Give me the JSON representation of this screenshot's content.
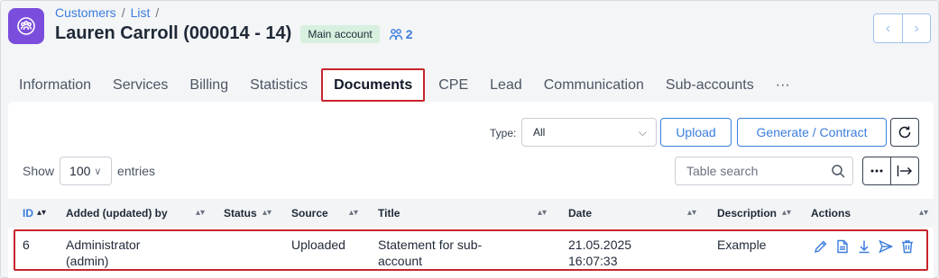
{
  "breadcrumb": {
    "items": [
      "Customers",
      "List"
    ],
    "separator": "/"
  },
  "header": {
    "title": "Lauren Carroll (000014 - 14)",
    "badge": "Main account",
    "subaccount_count": "2"
  },
  "tabs": [
    "Information",
    "Services",
    "Billing",
    "Statistics",
    "Documents",
    "CPE",
    "Lead",
    "Communication",
    "Sub-accounts",
    "···"
  ],
  "active_tab": "Documents",
  "toolbar": {
    "type_label": "Type:",
    "type_value": "All",
    "upload_label": "Upload",
    "generate_label": "Generate / Contract"
  },
  "entries": {
    "show_label": "Show",
    "value": "100",
    "suffix": "entries"
  },
  "search": {
    "placeholder": "Table search"
  },
  "table": {
    "columns": [
      "ID",
      "Added (updated) by",
      "Status",
      "Source",
      "Title",
      "Date",
      "Description",
      "Actions"
    ],
    "rows": [
      {
        "id": "6",
        "added_by_line1": "Administrator",
        "added_by_line2": "(admin)",
        "status": "",
        "source": "Uploaded",
        "title_line1": "Statement for sub-",
        "title_line2": "account",
        "date_line1": "21.05.2025",
        "date_line2": "16:07:33",
        "description": "Example"
      }
    ]
  },
  "colors": {
    "accent": "#3b7ddd",
    "app_icon": "#7b4ddc",
    "highlight": "#c8232c",
    "badge_bg": "#d8f0df"
  }
}
